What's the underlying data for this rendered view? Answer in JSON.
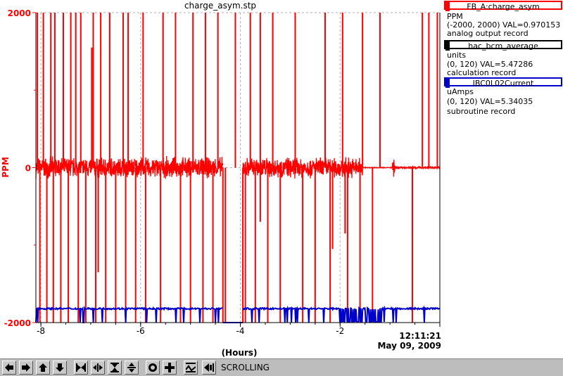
{
  "window": {
    "title": "charge_asym.stp"
  },
  "chart_data": {
    "type": "line",
    "title": "charge_asym.stp",
    "ylabel": "PPM",
    "xlabel": "(Hours)",
    "ylim": [
      -2000,
      2000
    ],
    "xlim": [
      -8.1,
      0
    ],
    "y_ticks": [
      "2000",
      "0",
      "-2000"
    ],
    "x_ticks": [
      "-8",
      "-6",
      "-4",
      "-2"
    ],
    "x_tick_values": [
      -8,
      -6,
      -4,
      -2
    ],
    "end_time": "12:11:21",
    "end_date": "May 09, 2009",
    "grid": true,
    "series": [
      {
        "name": "FB_A:charge_asym",
        "color": "#ff0000",
        "baseline": 0,
        "noise_amplitude": 150,
        "gaps": [
          [
            -4.35,
            -3.95
          ]
        ],
        "spikes_up": [
          -8.07,
          -7.95,
          -7.8,
          -7.72,
          -7.55,
          -7.4,
          -7.3,
          -7.2,
          -6.95,
          -6.8,
          -6.62,
          -6.35,
          -6.25,
          -5.95,
          -5.55,
          -5.3,
          -4.95,
          -4.7,
          -4.45,
          -4.1,
          -3.8,
          -3.6,
          -3.35,
          -2.9,
          -2.3,
          -1.95,
          -1.55,
          -1.2,
          -0.35,
          -0.22,
          -0.05
        ],
        "spikes_down": [
          -8.02,
          -7.88,
          -7.75,
          -7.6,
          -7.45,
          -7.25,
          -7.1,
          -6.9,
          -6.7,
          -6.5,
          -6.3,
          -6.1,
          -5.9,
          -5.6,
          -5.2,
          -5.0,
          -4.75,
          -4.55,
          -4.3,
          -3.9,
          -3.7,
          -3.45,
          -3.2,
          -2.75,
          -2.5,
          -2.2,
          -1.85,
          -1.6,
          -1.35,
          -0.55
        ],
        "spikes_partial": [
          [
            -6.98,
            1550
          ],
          [
            -7.55,
            1100
          ],
          [
            -6.85,
            -1350
          ],
          [
            -2.15,
            -1050
          ],
          [
            -1.9,
            -850
          ],
          [
            -0.55,
            -850
          ],
          [
            -3.6,
            -700
          ]
        ]
      },
      {
        "name": "hac_bcm_average",
        "color": "#000000",
        "units": "units",
        "value_text": "(0, 120) VAL=5.47286",
        "record": "calculation record"
      },
      {
        "name": "IBC0L02Current",
        "color": "#0000cc",
        "baseline": -1820,
        "low_value": -2000,
        "gaps": [
          [
            -4.35,
            -3.95
          ]
        ]
      }
    ]
  },
  "legend": {
    "entries": [
      {
        "name": "FB_A:charge_asym",
        "color": "#ff0000",
        "units": "PPM",
        "value_text": "(-2000, 2000) VAL=0.970153",
        "record": "analog output record"
      },
      {
        "name": "hac_bcm_average",
        "color": "#000000",
        "units": "units",
        "value_text": "(0, 120) VAL=5.47286",
        "record": "calculation record"
      },
      {
        "name": "IBC0L02Current",
        "color": "#0000cc",
        "units": "uAmps",
        "value_text": "(0, 120) VAL=5.34035",
        "record": "subroutine record"
      }
    ]
  },
  "toolbar": {
    "status_label": "SCROLLING",
    "buttons": [
      {
        "name": "pan-left-button",
        "icon": "arrow-left-icon"
      },
      {
        "name": "pan-right-button",
        "icon": "arrow-right-icon"
      },
      {
        "name": "pan-up-button",
        "icon": "arrow-up-icon"
      },
      {
        "name": "pan-down-button",
        "icon": "arrow-down-icon"
      },
      {
        "name": "zoom-in-x-button",
        "icon": "zoom-in-x-icon"
      },
      {
        "name": "zoom-out-x-button",
        "icon": "zoom-out-x-icon"
      },
      {
        "name": "zoom-in-y-button",
        "icon": "zoom-in-y-icon"
      },
      {
        "name": "zoom-out-y-button",
        "icon": "zoom-out-y-icon"
      },
      {
        "name": "auto-scale-button",
        "icon": "target-icon"
      },
      {
        "name": "reset-button",
        "icon": "plus-icon"
      },
      {
        "name": "style-button",
        "icon": "waveform-icon"
      },
      {
        "name": "scroll-mode-button",
        "icon": "scroll-left-icon"
      }
    ]
  }
}
